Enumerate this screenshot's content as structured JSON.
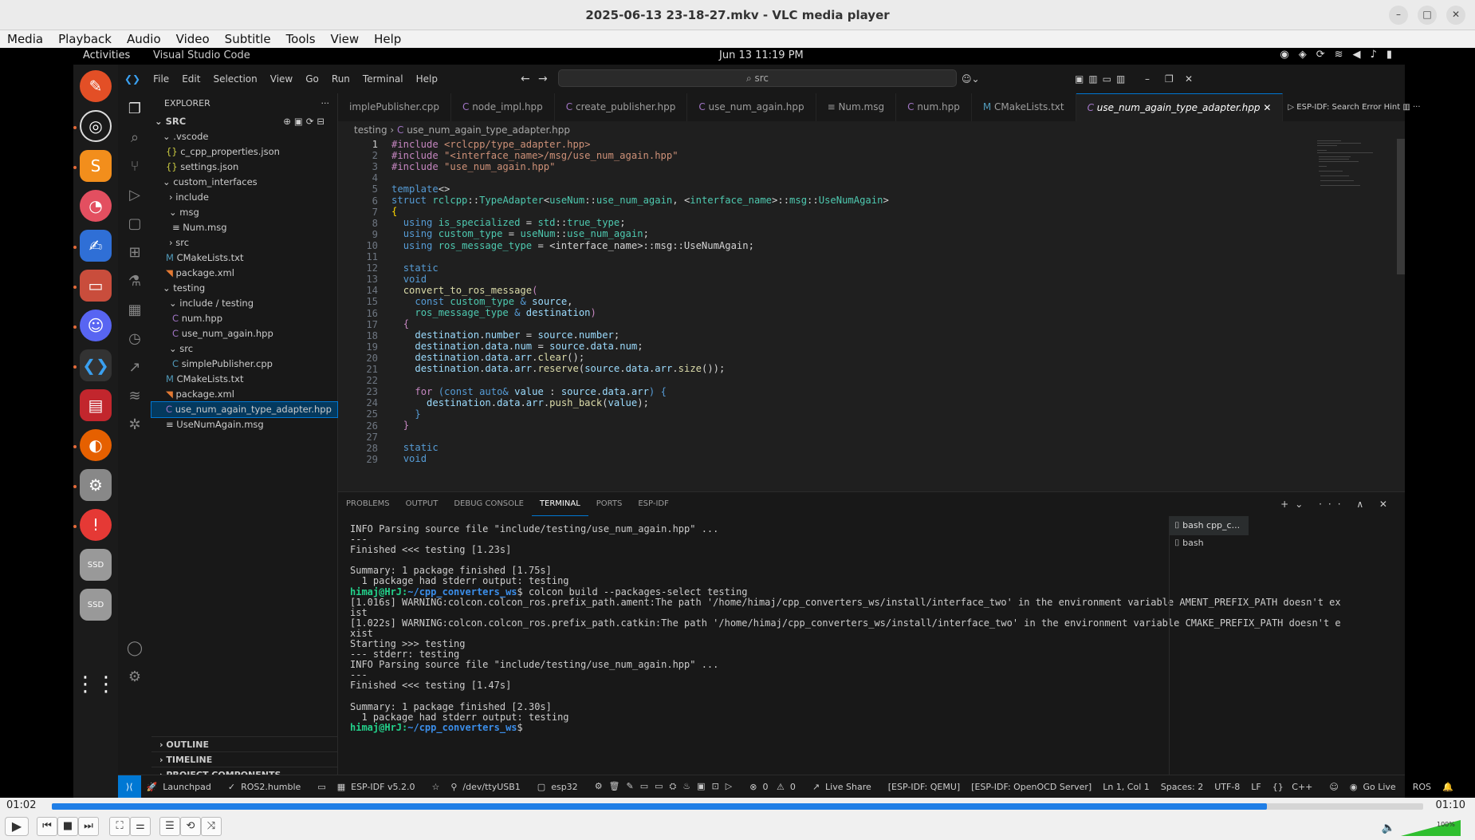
{
  "window": {
    "title": "2025-06-13 23-18-27.mkv - VLC media player"
  },
  "vlc_menu": [
    "Media",
    "Playback",
    "Audio",
    "Video",
    "Subtitle",
    "Tools",
    "View",
    "Help"
  ],
  "gnome": {
    "activities": "Activities",
    "app": "Visual Studio Code",
    "clock": "Jun 13  11:19 PM"
  },
  "vscode": {
    "menu": [
      "File",
      "Edit",
      "Selection",
      "View",
      "Go",
      "Run",
      "Terminal",
      "Help"
    ],
    "search": "src",
    "explorer_title": "EXPLORER",
    "root": "SRC",
    "tree": [
      ".vscode",
      "c_cpp_properties.json",
      "settings.json",
      "custom_interfaces",
      "include",
      "msg",
      "Num.msg",
      "src",
      "CMakeLists.txt",
      "package.xml",
      "testing",
      "include / testing",
      "num.hpp",
      "use_num_again.hpp",
      "src",
      "simplePublisher.cpp",
      "CMakeLists.txt",
      "package.xml",
      "use_num_again_type_adapter.hpp",
      "UseNumAgain.msg"
    ],
    "sections": [
      "OUTLINE",
      "TIMELINE",
      "PROJECT COMPONENTS"
    ],
    "tabs": [
      "implePublisher.cpp",
      "node_impl.hpp",
      "create_publisher.hpp",
      "use_num_again.hpp",
      "Num.msg",
      "num.hpp",
      "CMakeLists.txt",
      "use_num_again_type_adapter.hpp"
    ],
    "tab_extra": "ESP-IDF: Search Error Hint",
    "breadcrumb": [
      "testing",
      "use_num_again_type_adapter.hpp"
    ],
    "line_numbers": [
      "1",
      "2",
      "3",
      "4",
      "5",
      "6",
      "7",
      "8",
      "9",
      "10",
      "11",
      "12",
      "13",
      "14",
      "15",
      "16",
      "17",
      "18",
      "19",
      "20",
      "21",
      "22",
      "23",
      "24",
      "25",
      "26",
      "27",
      "28",
      "29"
    ],
    "panel_tabs": [
      "PROBLEMS",
      "OUTPUT",
      "DEBUG CONSOLE",
      "TERMINAL",
      "PORTS",
      "ESP-IDF"
    ],
    "terminal_lines": [
      "INFO Parsing source file \"include/testing/use_num_again.hpp\" ...",
      "---",
      "Finished <<< testing [1.23s]",
      "",
      "Summary: 1 package finished [1.75s]",
      "  1 package had stderr output: testing",
      "himaj@HrJ:~/cpp_converters_ws$ colcon build --packages-select testing",
      "[1.016s] WARNING:colcon.colcon_ros.prefix_path.ament:The path '/home/himaj/cpp_converters_ws/install/interface_two' in the environment variable AMENT_PREFIX_PATH doesn't ex",
      "ist",
      "[1.022s] WARNING:colcon.colcon_ros.prefix_path.catkin:The path '/home/himaj/cpp_converters_ws/install/interface_two' in the environment variable CMAKE_PREFIX_PATH doesn't e",
      "xist",
      "Starting >>> testing",
      "--- stderr: testing",
      "INFO Parsing source file \"include/testing/use_num_again.hpp\" ...",
      "---",
      "Finished <<< testing [1.47s]",
      "",
      "Summary: 1 package finished [2.30s]",
      "  1 package had stderr output: testing",
      "himaj@HrJ:~/cpp_converters_ws$ "
    ],
    "terminal_list": [
      "bash  cpp_c...",
      "bash"
    ],
    "status": [
      "Launchpad",
      "ROS2.humble",
      "ESP-IDF v5.2.0",
      "/dev/ttyUSB1",
      "esp32",
      "0",
      "0",
      "Live Share",
      "[ESP-IDF: QEMU]",
      "[ESP-IDF: OpenOCD Server]",
      "Ln 1, Col 1",
      "Spaces: 2",
      "UTF-8",
      "LF",
      "C++",
      "Go Live",
      "ROS"
    ]
  },
  "vlc": {
    "time_current": "01:02",
    "time_total": "01:10",
    "progress": 0.886,
    "volume": "100%"
  }
}
